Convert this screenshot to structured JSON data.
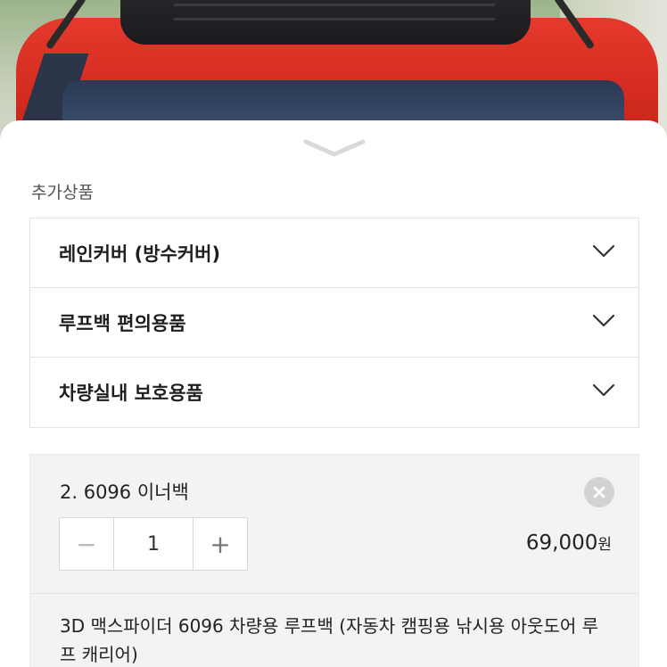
{
  "sheet": {
    "section_title": "추가상품",
    "handle_icon": "chevron-down-icon"
  },
  "accordion": {
    "items": [
      {
        "label": "레인커버 (방수커버)",
        "icon": "chevron-down-icon"
      },
      {
        "label": "루프백 편의용품",
        "icon": "chevron-down-icon"
      },
      {
        "label": "차량실내 보호용품",
        "icon": "chevron-down-icon"
      }
    ]
  },
  "selected_item": {
    "title": "2. 6096 이너백",
    "remove_icon": "close-icon",
    "quantity": "1",
    "minus_label": "−",
    "plus_label": "+",
    "price": "69,000",
    "price_unit": "원",
    "description": "3D 맥스파이더 6096 차량용 루프백 (자동차 캠핑용 낚시용 아웃도어 루프 캐리어)"
  },
  "colors": {
    "car_red": "#d8281e",
    "text_primary": "#1f1f1f",
    "panel_bg": "#f3f3f3"
  }
}
